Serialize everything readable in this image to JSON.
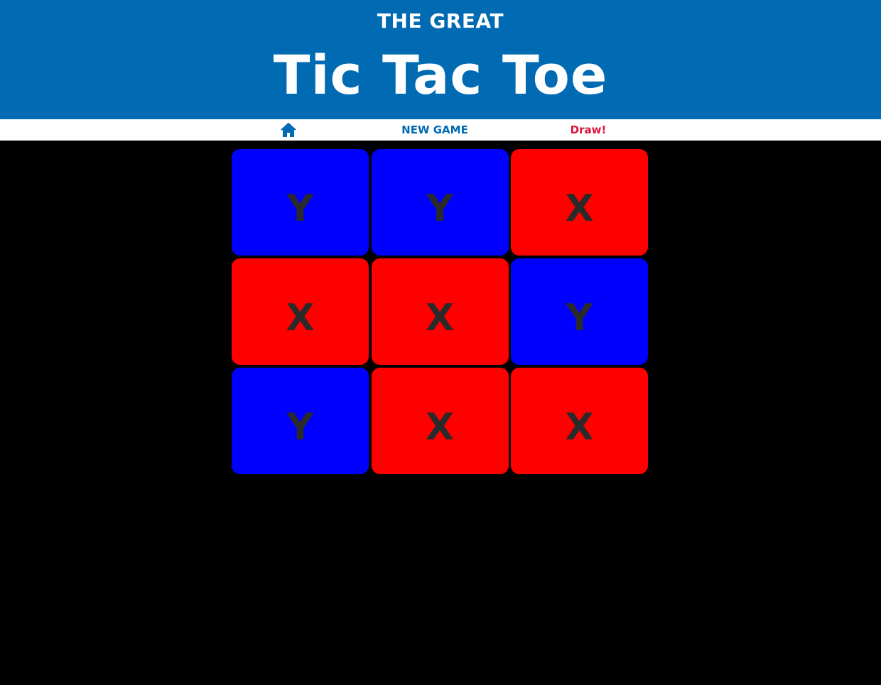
{
  "header": {
    "subtitle": "THE GREAT",
    "title": "Tic Tac Toe"
  },
  "nav": {
    "home_icon": "home-icon",
    "new_game_label": "NEW GAME",
    "status": "Draw!"
  },
  "colors": {
    "header_bg": "#006bb3",
    "x_cell": "#ff0000",
    "y_cell": "#0000ff",
    "status": "#dc143c",
    "mark": "#2a2a2a"
  },
  "board": {
    "cells": [
      {
        "mark": "Y",
        "color": "#0000ff"
      },
      {
        "mark": "Y",
        "color": "#0000ff"
      },
      {
        "mark": "X",
        "color": "#ff0000"
      },
      {
        "mark": "X",
        "color": "#ff0000"
      },
      {
        "mark": "X",
        "color": "#ff0000"
      },
      {
        "mark": "Y",
        "color": "#0000ff"
      },
      {
        "mark": "Y",
        "color": "#0000ff"
      },
      {
        "mark": "X",
        "color": "#ff0000"
      },
      {
        "mark": "X",
        "color": "#ff0000"
      }
    ]
  }
}
